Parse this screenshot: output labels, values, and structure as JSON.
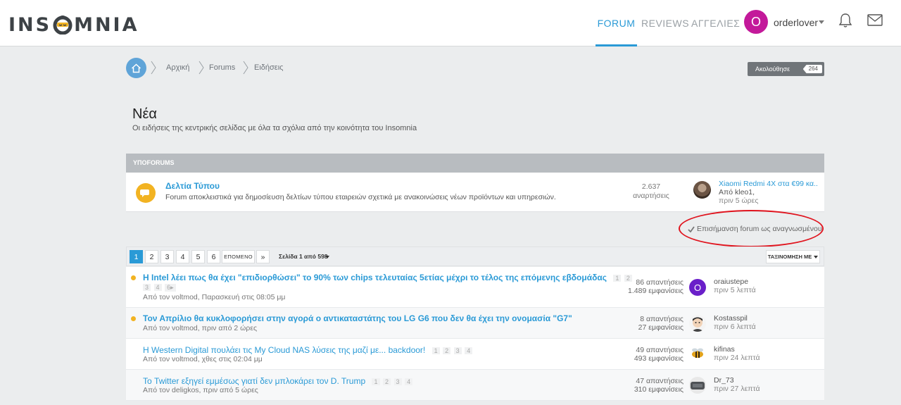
{
  "header": {
    "logo_text": "INSOMNIA",
    "nav": {
      "forum": "FORUM",
      "reviews": "REVIEWS",
      "ads": "ΑΓΓΕΛΙΕΣ"
    },
    "user": {
      "avatar_letter": "O",
      "name": "orderlover"
    },
    "accent_color": "#2a9ad6"
  },
  "breadcrumb": {
    "items": [
      "Αρχική",
      "Forums",
      "Ειδήσεις"
    ]
  },
  "follow": {
    "label": "Ακολούθησε",
    "count": "264"
  },
  "page": {
    "title": "Νέα",
    "description": "Οι ειδήσεις της κεντρικής σελίδας με όλα τα σχόλια από την κοινότητα του Insomnia"
  },
  "subforums": {
    "header": "ΥΠΟFORUMS",
    "items": [
      {
        "title": "Δελτία Τύπου",
        "description": "Forum αποκλειστικά για δημοσίευση δελτίων τύπου εταιρειών σχετικά με ανακοινώσεις νέων προϊόντων και υπηρεσιών.",
        "count": "2.637",
        "count_label": "αναρτήσεις",
        "last_title": "Xiaomi Redmi 4X στα €99 κα...",
        "last_by": "Από kleo1,",
        "last_time": "πριν 5 ώρες"
      }
    ]
  },
  "mark_read": {
    "label": "Επισήμανση forum ως αναγνωσμένου"
  },
  "pagination": {
    "pages": [
      "1",
      "2",
      "3",
      "4",
      "5",
      "6"
    ],
    "next": "ΕΠΟΜΕΝΟ",
    "last": "»",
    "info": "Σελίδα 1 από 598",
    "sort": "ΤΑΞΙΝΟΜΗΣΗ ΜΕ"
  },
  "threads": [
    {
      "title": "Η Intel λέει πως θα έχει \"επιδιορθώσει\" το 90% των chips τελευταίας 5ετίας μέχρι το τέλος της επόμενης εβδομάδας",
      "pages_inline": [
        "1",
        "2"
      ],
      "pages_wrap": [
        "3",
        "4",
        "6▸"
      ],
      "meta": "Από τον voltmod, Παρασκευή στις 08:05 μμ",
      "replies": "86 απαντήσεις",
      "views": "1.489 εμφανίσεις",
      "last_user": "oraiustepe",
      "last_time": "πριν 5 λεπτά",
      "avatar_letter": "O",
      "avatar_color": "#6a1fc9"
    },
    {
      "title": "Τον Απρίλιο θα κυκλοφορήσει στην αγορά ο αντικαταστάτης του LG G6 που δεν θα έχει την ονομασία \"G7\"",
      "meta": "Από τον voltmod, πριν από 2 ώρες",
      "replies": "8 απαντήσεις",
      "views": "27 εμφανίσεις",
      "last_user": "Kostasspil",
      "last_time": "πριν 6 λεπτά"
    },
    {
      "title": "Η Western Digital πουλάει τις My Cloud NAS λύσεις της μαζί με... backdoor!",
      "pages_inline": [
        "1",
        "2",
        "3",
        "4"
      ],
      "meta": "Από τον voltmod, χθες στις 02:04 μμ",
      "replies": "49 απαντήσεις",
      "views": "493 εμφανίσεις",
      "last_user": "kifinas",
      "last_time": "πριν 24 λεπτά"
    },
    {
      "title": "Το Twitter εξηγεί εμμέσως γιατί δεν μπλοκάρει τον D. Trump",
      "pages_inline": [
        "1",
        "2",
        "3",
        "4"
      ],
      "meta": "Από τον deligkos, πριν από 5 ώρες",
      "replies": "47 απαντήσεις",
      "views": "310 εμφανίσεις",
      "last_user": "Dr_73",
      "last_time": "πριν 27 λεπτά"
    }
  ]
}
